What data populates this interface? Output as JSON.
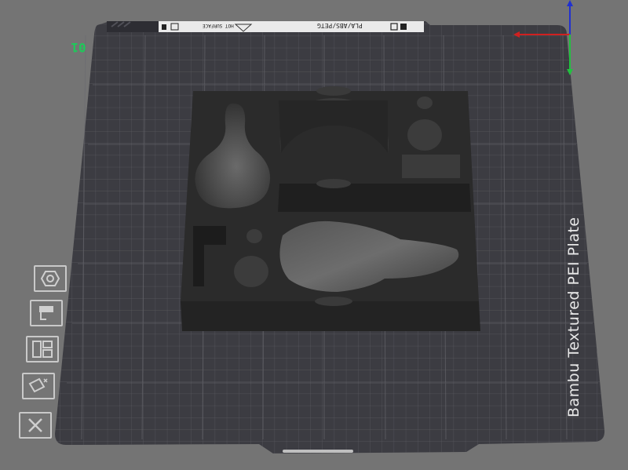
{
  "plate": {
    "name_label": "Bambu Textured PEI Plate",
    "number": "01",
    "filament_label": "PLA/ABS/PETG",
    "hot_surface_label": "HOT SURFACE"
  },
  "toolbar": {
    "items": [
      {
        "name": "orient",
        "icon": "hexagon-nut-icon"
      },
      {
        "name": "auto-place",
        "icon": "bucket-icon"
      },
      {
        "name": "arrange",
        "icon": "layout-grid-icon"
      },
      {
        "name": "auto-orient",
        "icon": "rotate-plate-icon"
      },
      {
        "name": "remove",
        "icon": "close-icon"
      }
    ]
  },
  "axes": {
    "x_color": "#d02020",
    "y_color": "#22c040",
    "z_color": "#2030d0"
  },
  "colors": {
    "background": "#747474",
    "plate": "#3e3e44",
    "model": "#2a2a2a",
    "plate_label": "#1fc85a"
  }
}
